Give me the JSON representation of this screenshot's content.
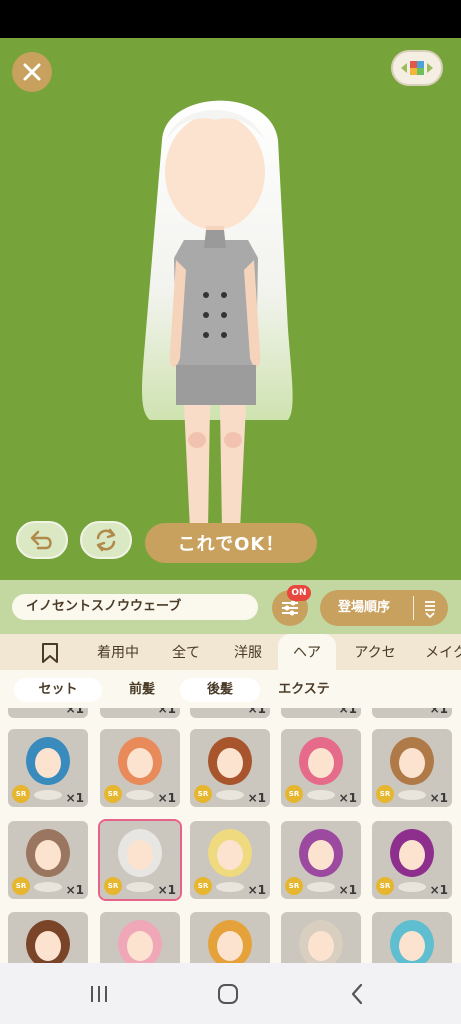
{
  "top": {
    "ok_label": "これでOK！"
  },
  "toolbar": {
    "search_value": "イノセントスノウウェーブ",
    "filter_badge": "ON",
    "sort_label": "登場順序"
  },
  "tabs": [
    {
      "label": "着用中"
    },
    {
      "label": "全て"
    },
    {
      "label": "洋服"
    },
    {
      "label": "ヘア",
      "active": true
    },
    {
      "label": "アクセ"
    },
    {
      "label": "メイク"
    }
  ],
  "subtabs": [
    {
      "label": "セット"
    },
    {
      "label": "前髪"
    },
    {
      "label": "後髪"
    },
    {
      "label": "エクステ"
    }
  ],
  "grid": {
    "partial_row_qty": "×1",
    "items": [
      {
        "rarity": "SR",
        "qty": "×1",
        "hair_color": "#3a8bbd"
      },
      {
        "rarity": "SR",
        "qty": "×1",
        "hair_color": "#e88a5a"
      },
      {
        "rarity": "SR",
        "qty": "×1",
        "hair_color": "#a8552e"
      },
      {
        "rarity": "SR",
        "qty": "×1",
        "hair_color": "#e66a8a"
      },
      {
        "rarity": "SR",
        "qty": "×1",
        "hair_color": "#b07a48"
      },
      {
        "rarity": "SR",
        "qty": "×1",
        "hair_color": "#9a7560"
      },
      {
        "rarity": "SR",
        "qty": "×1",
        "hair_color": "#e8e6e3",
        "selected": true
      },
      {
        "rarity": "SR",
        "qty": "×1",
        "hair_color": "#f0da80"
      },
      {
        "rarity": "SR",
        "qty": "×1",
        "hair_color": "#9c4aa0"
      },
      {
        "rarity": "SR",
        "qty": "×1",
        "hair_color": "#8e2f8e"
      }
    ],
    "bottom_row_colors": [
      "#7a4428",
      "#f0a8b8",
      "#e6a23a",
      "#d8cfc0",
      "#5fbfd0"
    ]
  },
  "colors": {
    "stage_bg": "#76a33a",
    "accent_gold": "#c9a15e",
    "badge_red": "#e8473e"
  },
  "icons": {
    "close": "close-icon",
    "palette": "palette-icon",
    "undo": "undo-icon",
    "rotate": "rotate-icon",
    "filter": "sliders-icon",
    "sort": "sort-icon",
    "bookmark": "bookmark-icon",
    "nav_recents": "recents-icon",
    "nav_home": "home-icon",
    "nav_back": "back-icon"
  }
}
